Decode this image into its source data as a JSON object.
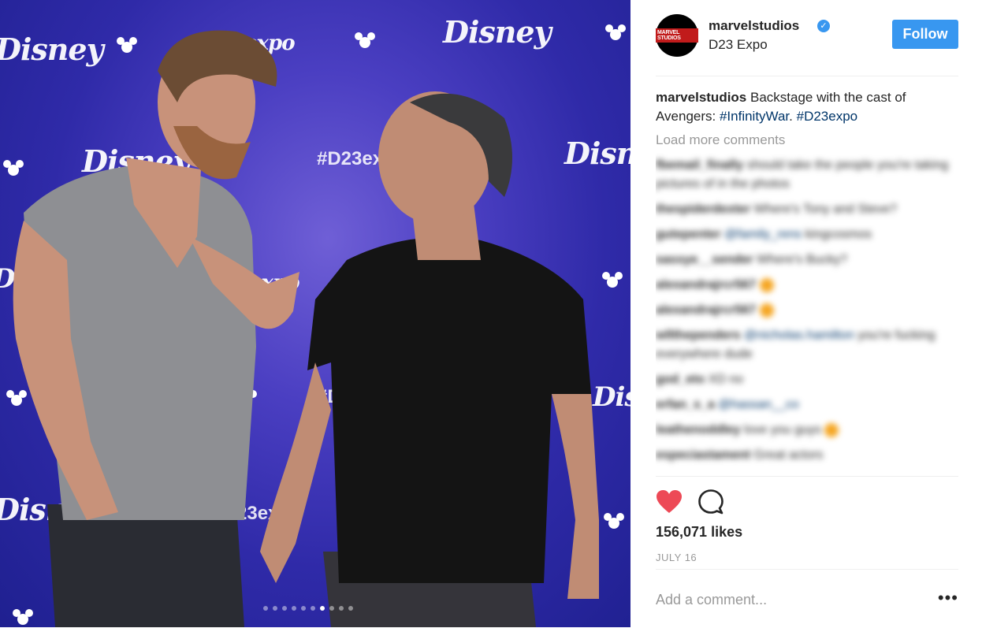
{
  "photo": {
    "backdrop_texts": [
      "Disney",
      "expo",
      "Disney",
      "#D23expo",
      "Disney",
      "Disney",
      "expo",
      "Dis",
      "#D",
      "Disney",
      "Dis",
      "23exp"
    ],
    "carousel": {
      "count": 10,
      "active_index": 6
    },
    "colors": {
      "backdrop": "#3a33b4",
      "shirt_left": "#8e8f93",
      "shirt_right": "#141414"
    }
  },
  "header": {
    "avatar_text": "MARVEL STUDIOS",
    "username": "marvelstudios",
    "verified_icon": "verified-badge-icon",
    "location": "D23 Expo",
    "follow_label": "Follow"
  },
  "caption": {
    "username": "marvelstudios",
    "text": "Backstage with the cast of Avengers:",
    "hashtag1": "#InfinityWar",
    "sep": ". ",
    "hashtag2": "#D23expo"
  },
  "load_more": "Load more comments",
  "comments": [
    {
      "user": "fbemail_finally",
      "text": "should take the people you're taking pictures of in the photos",
      "mention": ""
    },
    {
      "user": "thespiderdexter",
      "text": "Where's Tony and Steve?",
      "mention": ""
    },
    {
      "user": "gutepenter",
      "text": "kingcosmos",
      "mention": "@family_rens"
    },
    {
      "user": "sassye__sender",
      "text": "Where's Bucky?",
      "mention": ""
    },
    {
      "user": "alexandrajrcr567",
      "text": "",
      "mention": "",
      "emoji": true
    },
    {
      "user": "alexandrajrcr567",
      "text": "",
      "mention": "",
      "emoji": true
    },
    {
      "user": "wllthependers",
      "text": "you're fucking everywhere dude",
      "mention": "@nicholas.hamilton"
    },
    {
      "user": "god_eto",
      "text": "XD no",
      "mention": ""
    },
    {
      "user": "erfan_s_a",
      "text": "",
      "mention": "@hassan__co"
    },
    {
      "user": "leathenoddley",
      "text": "love you guys",
      "mention": "",
      "emoji": true
    },
    {
      "user": "especiastament",
      "text": "Great actors",
      "mention": ""
    }
  ],
  "actions": {
    "heart_icon": "heart-icon",
    "comment_icon": "comment-icon",
    "like_color": "#ed4956"
  },
  "likes": "156,071 likes",
  "date": "JULY 16",
  "add_comment": {
    "placeholder": "Add a comment...",
    "more_icon": "•••"
  }
}
